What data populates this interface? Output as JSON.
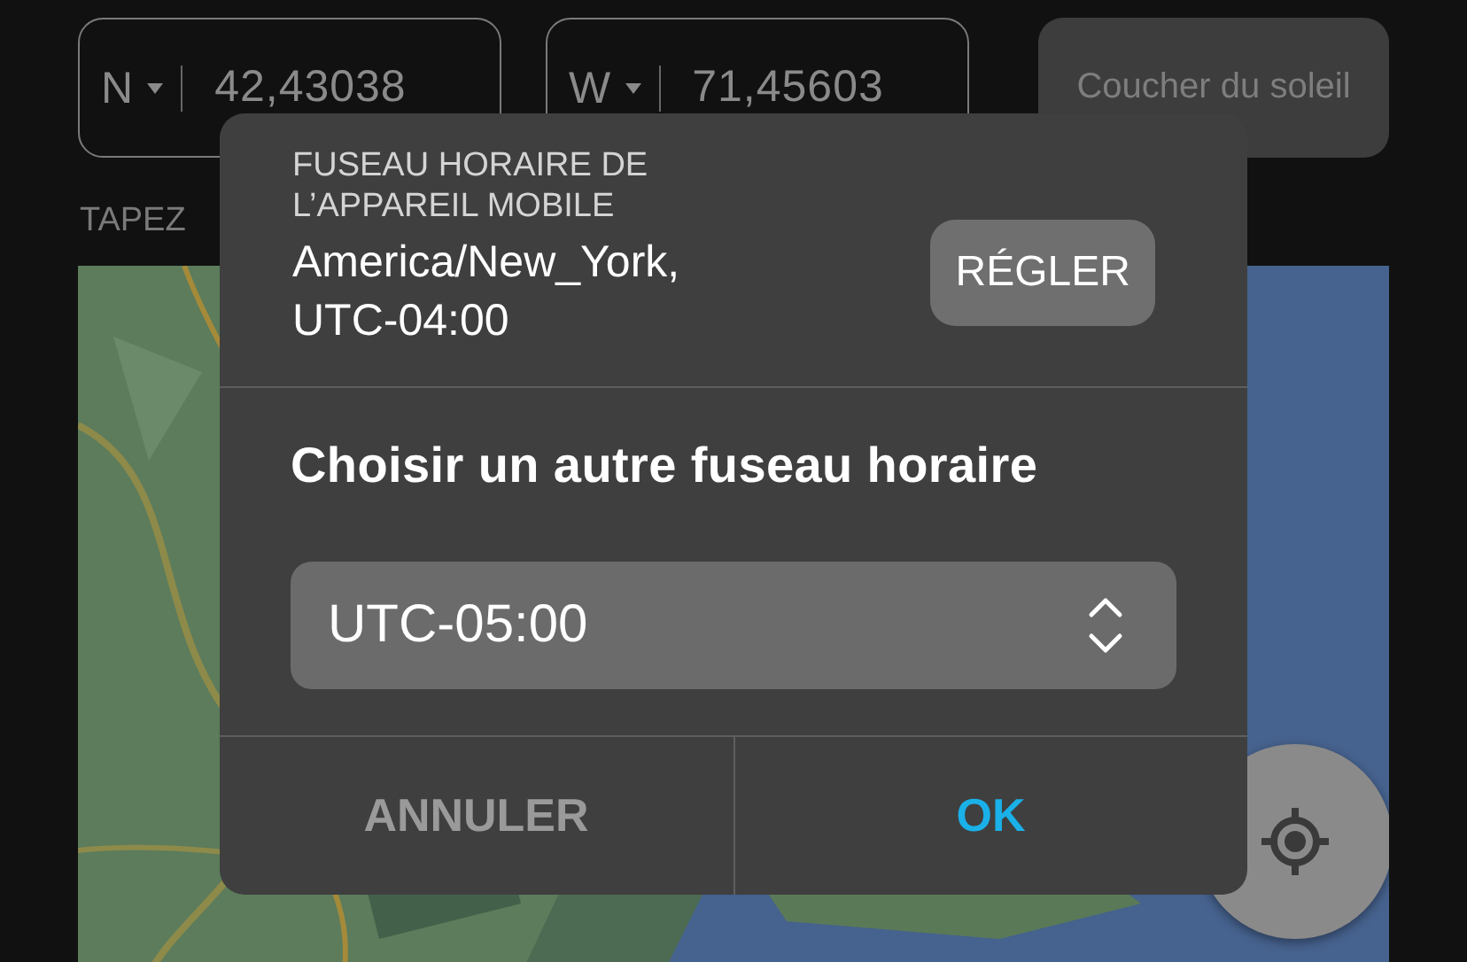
{
  "coordinates": [
    {
      "hemisphere": "N",
      "value": "42,43038"
    },
    {
      "hemisphere": "W",
      "value": "71,45603"
    }
  ],
  "sunset_button": "Coucher du soleil",
  "hint": "TAPEZ",
  "dialog": {
    "device_timezone_label": "FUSEAU HORAIRE DE L’APPAREIL MOBILE",
    "device_timezone": "America/New_York, UTC-04:00",
    "set_button": "RÉGLER",
    "prompt": "Choisir un autre fuseau horaire",
    "timezone_select": {
      "value": "UTC-05:00"
    },
    "actions": [
      {
        "label": "ANNULER",
        "primary": false
      },
      {
        "label": "OK",
        "primary": true
      }
    ]
  }
}
